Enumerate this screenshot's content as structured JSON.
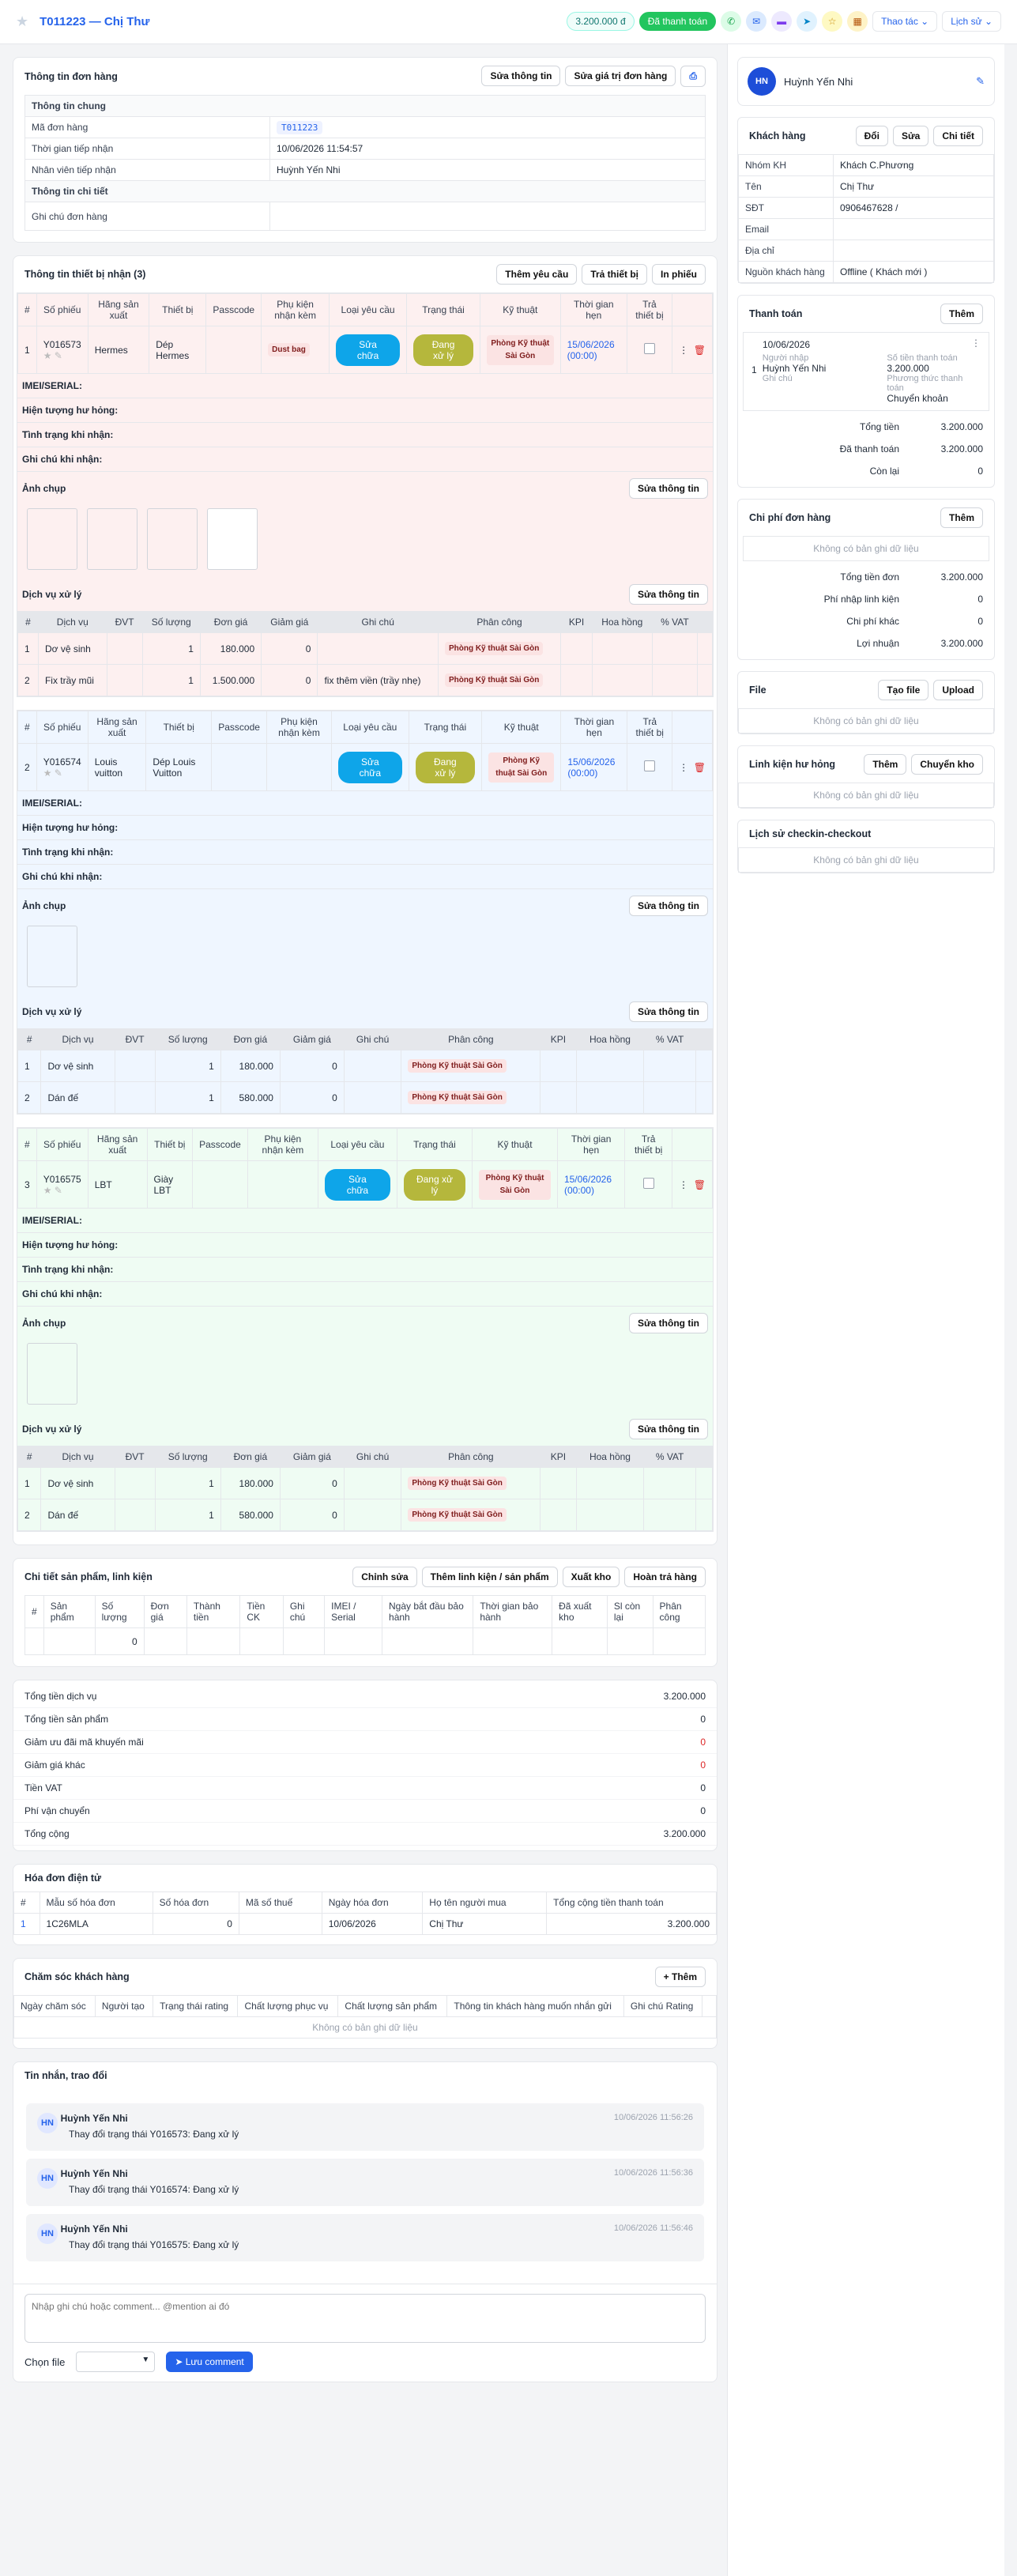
{
  "header": {
    "title": "T011223 — Chị Thư",
    "amount": "3.200.000 đ",
    "status": "Đã thanh toán",
    "actions": "Thao tác",
    "history": "Lịch sử"
  },
  "order": {
    "title": "Thông tin đơn hàng",
    "edit_info": "Sửa thông tin",
    "edit_value": "Sửa giá trị đơn hàng",
    "general": "Thông tin chung",
    "rows": [
      {
        "k": "Mã đơn hàng",
        "v": "T011223"
      },
      {
        "k": "Thời gian tiếp nhận",
        "v": "10/06/2026 11:54:57"
      },
      {
        "k": "Nhân viên tiếp nhận",
        "v": "Huỳnh Yến Nhi"
      }
    ],
    "detail": "Thông tin chi tiết",
    "note_label": "Ghi chú đơn hàng"
  },
  "devices": {
    "title": "Thông tin thiết bị nhận (3)",
    "btn_add": "Thêm yêu cầu",
    "btn_return": "Trả thiết bị",
    "btn_print": "In phiếu",
    "cols": [
      "#",
      "Số phiếu",
      "Hãng sản xuất",
      "Thiết bị",
      "Passcode",
      "Phụ kiện nhận kèm",
      "Loại yêu cầu",
      "Trạng thái",
      "Kỹ thuật",
      "Thời gian hẹn",
      "Trả thiết bị"
    ],
    "svc_cols": [
      "#",
      "Dịch vụ",
      "ĐVT",
      "Số lượng",
      "Đơn giá",
      "Giảm giá",
      "Ghi chú",
      "Phân công",
      "KPI",
      "Hoa hồng",
      "% VAT"
    ],
    "labels": {
      "imei": "IMEI/SERIAL:",
      "symptom": "Hiện tượng hư hỏng:",
      "condition": "Tình trạng khi nhận:",
      "note": "Ghi chú khi nhận:",
      "photos": "Ảnh chụp",
      "edit": "Sửa thông tin",
      "services": "Dịch vụ xử lý",
      "repair": "Sửa chữa",
      "processing": "Đang xử lý",
      "tech": "Phòng Kỹ thuật Sài Gòn"
    },
    "items": [
      {
        "idx": "1",
        "ticket": "Y016573",
        "brand": "Hermes",
        "device": "Dép Hermes",
        "acc": "Dust bag",
        "date": "15/06/2026",
        "time": "(00:00)",
        "photos": 4,
        "svcs": [
          {
            "i": "1",
            "name": "Dơ vệ sinh",
            "qty": "1",
            "price": "180.000",
            "disc": "0",
            "note": ""
          },
          {
            "i": "2",
            "name": "Fix trầy mũi",
            "qty": "1",
            "price": "1.500.000",
            "disc": "0",
            "note": "fix thêm viền (trầy nhẹ)"
          }
        ]
      },
      {
        "idx": "2",
        "ticket": "Y016574",
        "brand": "Louis vuitton",
        "device": "Dép Louis Vuitton",
        "acc": "",
        "date": "15/06/2026",
        "time": "(00:00)",
        "photos": 1,
        "svcs": [
          {
            "i": "1",
            "name": "Dơ vệ sinh",
            "qty": "1",
            "price": "180.000",
            "disc": "0",
            "note": ""
          },
          {
            "i": "2",
            "name": "Dán đế",
            "qty": "1",
            "price": "580.000",
            "disc": "0",
            "note": ""
          }
        ]
      },
      {
        "idx": "3",
        "ticket": "Y016575",
        "brand": "LBT",
        "device": "Giày LBT",
        "acc": "",
        "date": "15/06/2026",
        "time": "(00:00)",
        "photos": 1,
        "svcs": [
          {
            "i": "1",
            "name": "Dơ vệ sinh",
            "qty": "1",
            "price": "180.000",
            "disc": "0",
            "note": ""
          },
          {
            "i": "2",
            "name": "Dán đế",
            "qty": "1",
            "price": "580.000",
            "disc": "0",
            "note": ""
          }
        ]
      }
    ]
  },
  "products": {
    "title": "Chi tiết sản phẩm, linh kiện",
    "btns": [
      "Chỉnh sửa",
      "Thêm linh kiện / sản phẩm",
      "Xuất kho",
      "Hoàn trả hàng"
    ],
    "cols": [
      "#",
      "Sản phẩm",
      "Số lượng",
      "Đơn giá",
      "Thành tiền",
      "Tiền CK",
      "Ghi chú",
      "IMEI / Serial",
      "Ngày bắt đầu bảo hành",
      "Thời gian bảo hành",
      "Đã xuất kho",
      "Sl còn lại",
      "Phân công"
    ],
    "total_qty": "0"
  },
  "summary": [
    {
      "k": "Tổng tiền dịch vụ",
      "v": "3.200.000",
      "c": ""
    },
    {
      "k": "Tổng tiền sản phẩm",
      "v": "0",
      "c": ""
    },
    {
      "k": "Giảm ưu đãi mã khuyến mãi",
      "v": "0",
      "c": "red"
    },
    {
      "k": "Giảm giá khác",
      "v": "0",
      "c": "red"
    },
    {
      "k": "Tiền VAT",
      "v": "0",
      "c": ""
    },
    {
      "k": "Phí vận chuyển",
      "v": "0",
      "c": ""
    },
    {
      "k": "Tổng cộng",
      "v": "3.200.000",
      "c": ""
    }
  ],
  "invoice": {
    "title": "Hóa đơn điện tử",
    "cols": [
      "#",
      "Mẫu số hóa đơn",
      "Số hóa đơn",
      "Mã số thuế",
      "Ngày hóa đơn",
      "Họ tên người mua",
      "Tổng cộng tiền thanh toán"
    ],
    "row": [
      "1",
      "1C26MLA",
      "0",
      "",
      "10/06/2026",
      "Chị Thư",
      "3.200.000"
    ]
  },
  "care": {
    "title": "Chăm sóc khách hàng",
    "add": "+ Thêm",
    "cols": [
      "Ngày chăm sóc",
      "Người tạo",
      "Trạng thái rating",
      "Chất lượng phục vụ",
      "Chất lượng sản phẩm",
      "Thông tin khách hàng muốn nhắn gửi",
      "Ghi chú Rating"
    ],
    "empty": "Không có bản ghi dữ liệu"
  },
  "messages": {
    "title": "Tin nhắn, trao đổi",
    "items": [
      {
        "av": "HN",
        "name": "Huỳnh Yến Nhi",
        "text": "Thay đổi trạng thái Y016573: Đang xử lý",
        "time": "10/06/2026 11:56:26"
      },
      {
        "av": "HN",
        "name": "Huỳnh Yến Nhi",
        "text": "Thay đổi trạng thái Y016574: Đang xử lý",
        "time": "10/06/2026 11:56:36"
      },
      {
        "av": "HN",
        "name": "Huỳnh Yến Nhi",
        "text": "Thay đổi trạng thái Y016575: Đang xử lý",
        "time": "10/06/2026 11:56:46"
      }
    ],
    "placeholder": "Nhập ghi chú hoặc comment... @mention ai đó",
    "file_label": "Chọn file",
    "save": "Lưu comment"
  },
  "right": {
    "user": "Huỳnh Yến Nhi",
    "user_av": "HN",
    "customer": {
      "title": "Khách hàng",
      "btns": [
        "Đổi",
        "Sửa",
        "Chi tiết"
      ],
      "rows": [
        {
          "k": "Nhóm KH",
          "v": "Khách C.Phương"
        },
        {
          "k": "Tên",
          "v": "Chị Thư"
        },
        {
          "k": "SĐT",
          "v": "0906467628 /"
        },
        {
          "k": "Email",
          "v": ""
        },
        {
          "k": "Địa chỉ",
          "v": ""
        },
        {
          "k": "Nguồn khách hàng",
          "v": "Offline ( Khách mới )"
        }
      ]
    },
    "payment": {
      "title": "Thanh toán",
      "add": "Thêm",
      "date": "10/06/2026",
      "creator_l": "Người nhập",
      "creator": "Huỳnh Yến Nhi",
      "amount_l": "Số tiền thanh toán",
      "amount": "3.200.000",
      "note_l": "Ghi chú",
      "method_l": "Phương thức thanh toán",
      "method": "Chuyển khoản",
      "idx": "1",
      "sums": [
        {
          "k": "Tổng tiền",
          "v": "3.200.000"
        },
        {
          "k": "Đã thanh toán",
          "v": "3.200.000"
        },
        {
          "k": "Còn lại",
          "v": "0"
        }
      ]
    },
    "cost": {
      "title": "Chi phí đơn hàng",
      "add": "Thêm",
      "empty": "Không có bản ghi dữ liệu",
      "sums": [
        {
          "k": "Tổng tiền đơn",
          "v": "3.200.000"
        },
        {
          "k": "Phí nhập linh kiện",
          "v": "0"
        },
        {
          "k": "Chi phí khác",
          "v": "0"
        },
        {
          "k": "Lợi nhuận",
          "v": "3.200.000"
        }
      ]
    },
    "file": {
      "title": "File",
      "btns": [
        "Tạo file",
        "Upload"
      ],
      "empty": "Không có bản ghi dữ liệu"
    },
    "parts": {
      "title": "Linh kiện hư hỏng",
      "btns": [
        "Thêm",
        "Chuyển kho"
      ],
      "empty": "Không có bản ghi dữ liệu"
    },
    "checkin": {
      "title": "Lịch sử checkin-checkout",
      "empty": "Không có bản ghi dữ liệu"
    }
  }
}
